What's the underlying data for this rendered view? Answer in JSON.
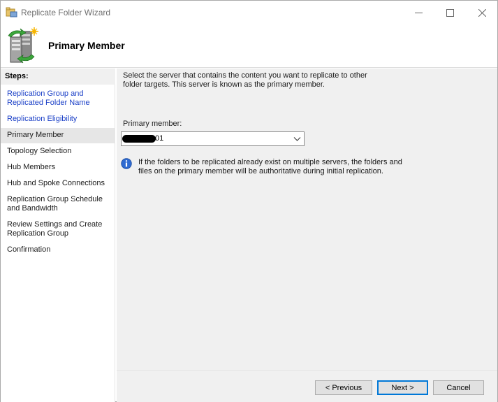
{
  "window": {
    "title": "Replicate Folder Wizard",
    "icon": "wizard-folder-icon"
  },
  "header": {
    "title": "Primary Member",
    "icon": "server-replication-icon"
  },
  "steps": {
    "heading": "Steps:",
    "items": [
      {
        "label": "Replication Group and Replicated Folder Name",
        "state": "link"
      },
      {
        "label": "Replication Eligibility",
        "state": "link"
      },
      {
        "label": "Primary Member",
        "state": "current"
      },
      {
        "label": "Topology Selection",
        "state": "pending"
      },
      {
        "label": "Hub Members",
        "state": "pending"
      },
      {
        "label": "Hub and Spoke Connections",
        "state": "pending"
      },
      {
        "label": "Replication Group Schedule and Bandwidth",
        "state": "pending"
      },
      {
        "label": "Review Settings and Create Replication Group",
        "state": "pending"
      },
      {
        "label": "Confirmation",
        "state": "pending"
      }
    ]
  },
  "main": {
    "intro": "Select the server that contains the content you want to replicate to other folder targets. This server is known as the primary member.",
    "primary_member_label": "Primary member:",
    "primary_member_value": "01",
    "info_text": "If the folders to be replicated already exist on multiple servers, the folders and files on the primary member will be authoritative during initial replication."
  },
  "buttons": {
    "previous": "< Previous",
    "next": "Next >",
    "cancel": "Cancel"
  },
  "colors": {
    "link": "#1a3fc7",
    "panel": "#f0f0f0",
    "focus": "#0078d7"
  }
}
